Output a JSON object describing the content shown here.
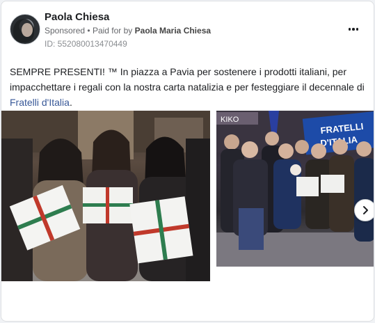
{
  "post": {
    "author": "Paola Chiesa",
    "sponsored": "Sponsored",
    "separator": "•",
    "paid_for_prefix": "Paid for by",
    "paid_for_name": "Paola Maria Chiesa",
    "ad_id": "ID: 552080013470449",
    "text_main": "SEMPRE PRESENTI! ™ In piazza a Pavia per sostenere i prodotti italiani, per impacchettare i regali con la nostra carta natalizia e per festeggiare il decennale di",
    "text_link": "Fratelli d'Italia",
    "text_end": "."
  },
  "photos": {
    "second_banner_text_1": "FRATELLI",
    "second_banner_text_2": "D'ITALIA",
    "store_sign": "KIKO"
  },
  "icons": {
    "more": "more-horizontal-icon",
    "next": "chevron-right-icon"
  },
  "colors": {
    "link": "#385898",
    "banner": "#1d4ba8"
  }
}
